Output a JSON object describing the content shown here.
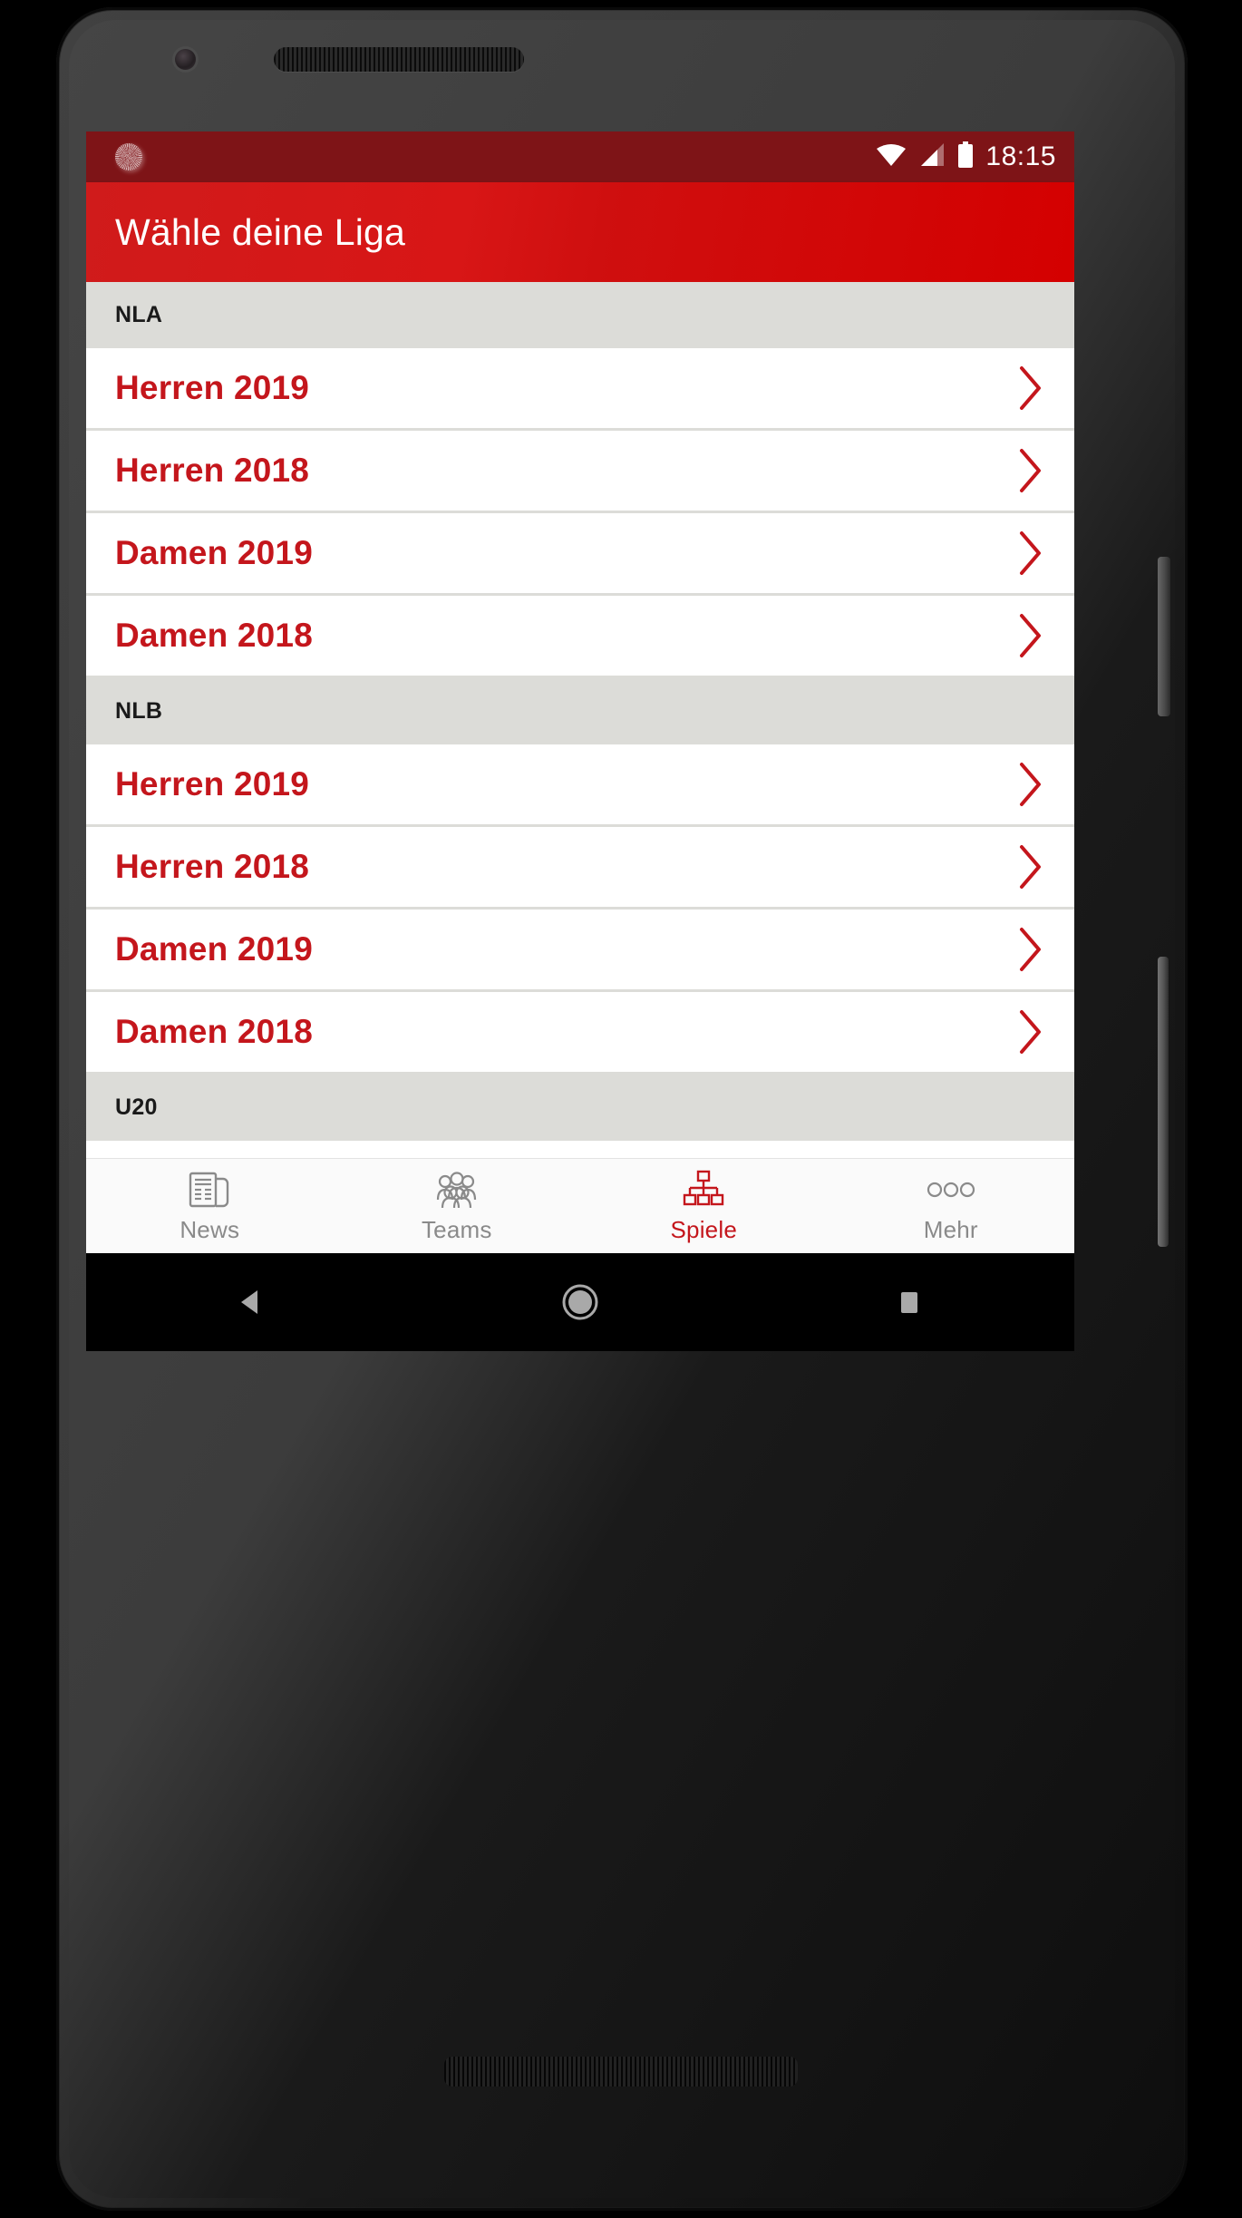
{
  "status_bar": {
    "notification_icon": "sync-icon",
    "wifi_icon": "wifi-icon",
    "cellular_icon": "cellular-signal-icon",
    "battery_icon": "battery-full-icon",
    "time": "18:15"
  },
  "app_bar": {
    "title": "Wähle deine Liga",
    "background_color": "#d40000"
  },
  "colors": {
    "accent_red": "#c4161c",
    "app_bar_red": "#d40000",
    "status_bar_red": "#7e1417",
    "section_header_gray": "#dcdcd8",
    "nav_inactive_gray": "#8a8a8a"
  },
  "sections": [
    {
      "header": "NLA",
      "rows": [
        {
          "label": "Herren 2019",
          "chevron": "chevron-right-icon"
        },
        {
          "label": "Herren 2018",
          "chevron": "chevron-right-icon"
        },
        {
          "label": "Damen 2019",
          "chevron": "chevron-right-icon"
        },
        {
          "label": "Damen 2018",
          "chevron": "chevron-right-icon"
        }
      ]
    },
    {
      "header": "NLB",
      "rows": [
        {
          "label": "Herren 2019",
          "chevron": "chevron-right-icon"
        },
        {
          "label": "Herren 2018",
          "chevron": "chevron-right-icon"
        },
        {
          "label": "Damen 2019",
          "chevron": "chevron-right-icon"
        },
        {
          "label": "Damen 2018",
          "chevron": "chevron-right-icon"
        }
      ]
    },
    {
      "header": "U20",
      "rows": []
    }
  ],
  "bottom_nav": {
    "items": [
      {
        "label": "News",
        "icon": "newspaper-icon",
        "active": false
      },
      {
        "label": "Teams",
        "icon": "people-group-icon",
        "active": false
      },
      {
        "label": "Spiele",
        "icon": "tournament-tree-icon",
        "active": true
      },
      {
        "label": "Mehr",
        "icon": "more-dots-icon",
        "active": false
      }
    ]
  },
  "system_nav": {
    "back": "back-triangle-icon",
    "home": "home-circle-icon",
    "recents": "recents-square-icon"
  }
}
